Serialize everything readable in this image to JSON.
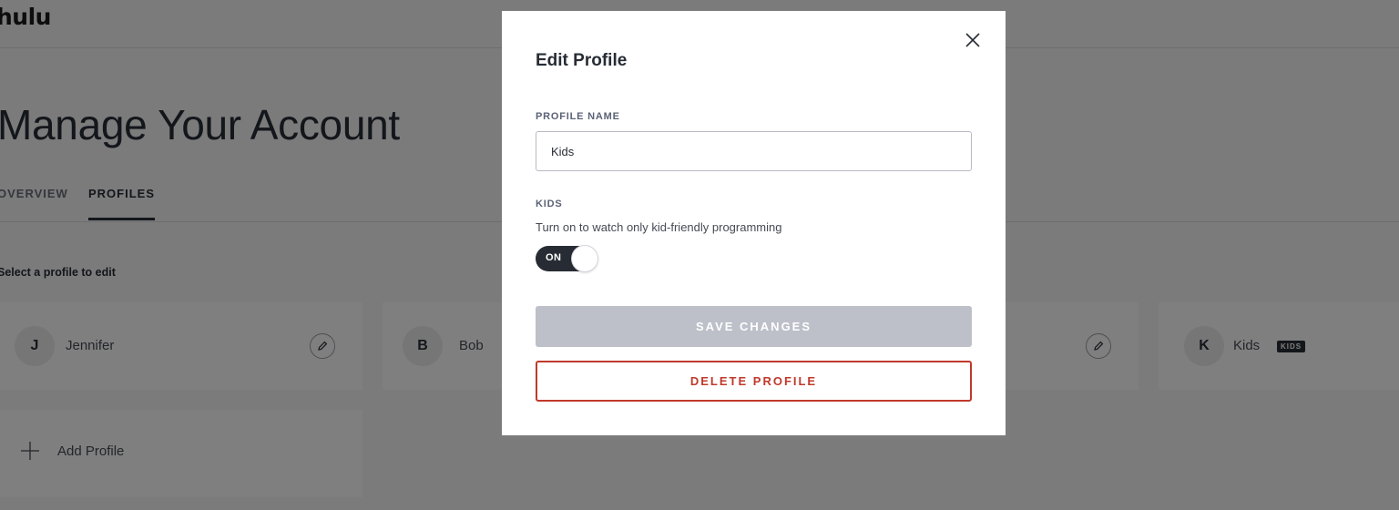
{
  "header": {
    "logo": "hulu"
  },
  "page": {
    "title": "Manage Your Account",
    "tabs": [
      {
        "label": "OVERVIEW",
        "active": false
      },
      {
        "label": "PROFILES",
        "active": true
      }
    ],
    "select_label": "Select a profile to edit",
    "profiles": [
      {
        "initial": "J",
        "name": "Jennifer",
        "kids_badge": ""
      },
      {
        "initial": "B",
        "name": "Bob",
        "kids_badge": ""
      },
      {
        "initial": "",
        "name": "",
        "kids_badge": ""
      },
      {
        "initial": "K",
        "name": "Kids",
        "kids_badge": "KIDS"
      }
    ],
    "add_profile_label": "Add Profile"
  },
  "modal": {
    "title": "Edit Profile",
    "profile_name_label": "PROFILE NAME",
    "profile_name_value": "Kids",
    "kids_label": "KIDS",
    "kids_description": "Turn on to watch only kid-friendly programming",
    "kids_toggle_state": "ON",
    "save_label": "SAVE CHANGES",
    "delete_label": "DELETE PROFILE"
  },
  "colors": {
    "brand_dark": "#272c34",
    "delete_red": "#c0392b",
    "disabled_button": "#bdc0c9"
  }
}
